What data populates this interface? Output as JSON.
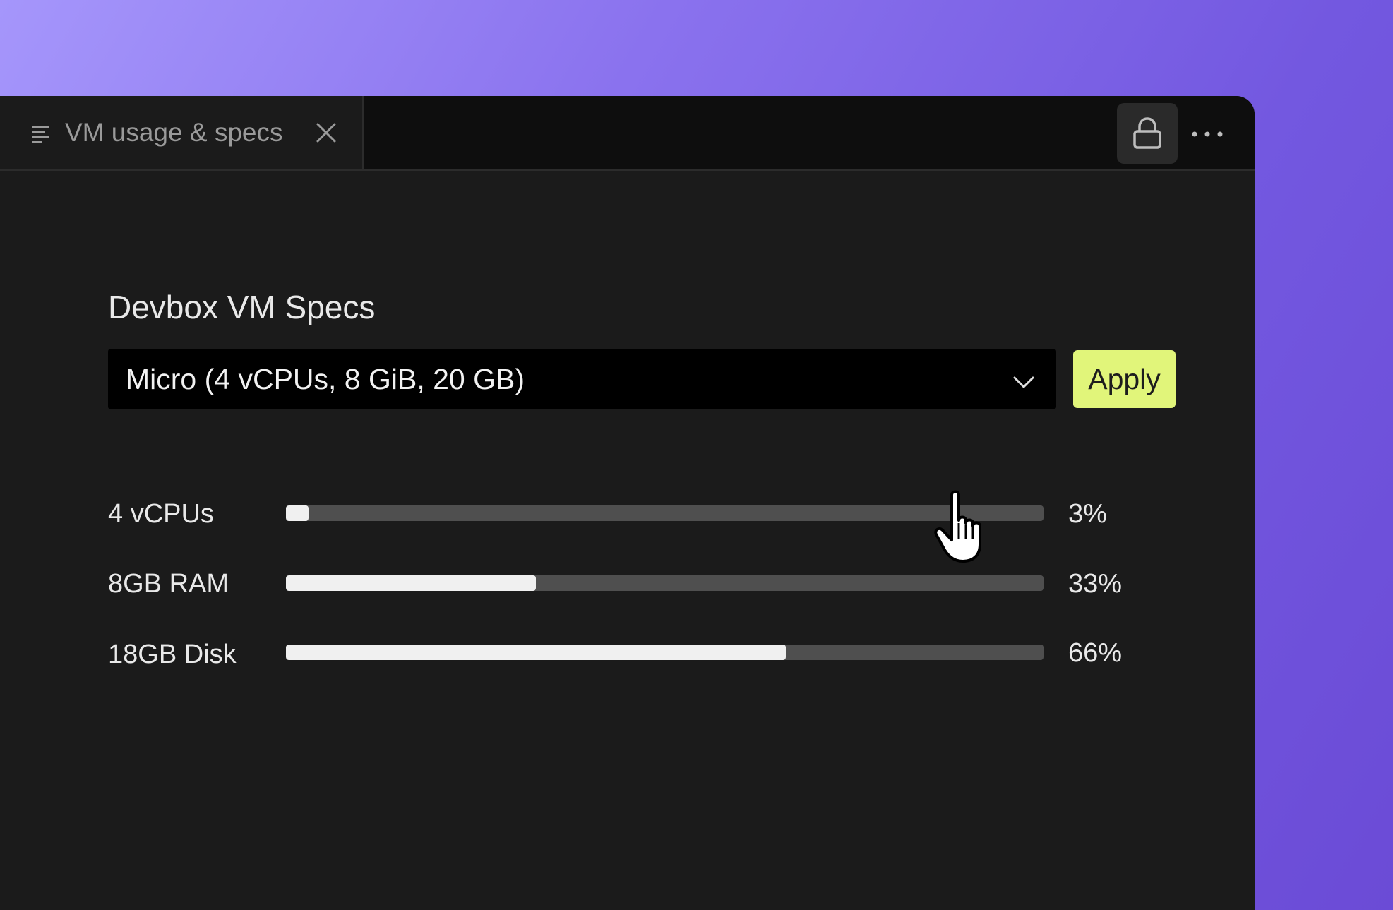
{
  "tab": {
    "label": "VM usage & specs",
    "icon": "list-icon",
    "close_icon": "close-icon"
  },
  "toolbar": {
    "lock_icon": "lock-icon",
    "more_icon": "more-horizontal-icon"
  },
  "specs": {
    "title": "Devbox VM Specs",
    "selected_option": "Micro (4 vCPUs, 8 GiB, 20 GB)",
    "apply_label": "Apply"
  },
  "metrics": [
    {
      "label": "4 vCPUs",
      "percent_text": "3%",
      "percent": 3
    },
    {
      "label": "8GB RAM",
      "percent_text": "33%",
      "percent": 33
    },
    {
      "label": "18GB Disk",
      "percent_text": "66%",
      "percent": 66
    }
  ],
  "colors": {
    "accent": "#e1f57a",
    "background_gradient_start": "#a596fb",
    "background_gradient_end": "#6b4bd6",
    "panel": "#1b1b1b",
    "titlebar": "#0e0e0e"
  }
}
